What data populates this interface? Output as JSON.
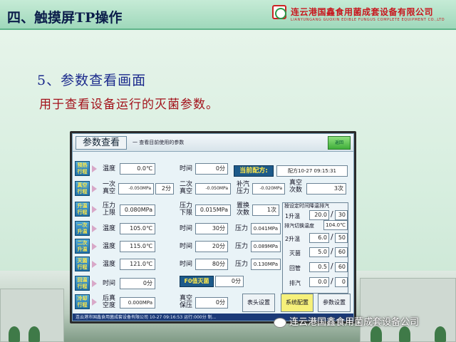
{
  "slide": {
    "title": "四、触摸屏TP操作",
    "company_cn": "连云港国鑫食用菌成套设备有限公司",
    "company_en": "LIANYUNGANG GUOXIN EDIBLE FUNGUS COMPLETE EQUIPMENT CO.,LTD",
    "sub_heading": "5、参数查看画面",
    "description": "用于查看设备运行的灭菌参数。",
    "watermark": "连云港国鑫食用菌成套设备公司"
  },
  "hmi": {
    "title": "参数查看",
    "subtitle": "一 查看目前使用的参数",
    "return_label": "返回",
    "recipe_label": "当前配方:",
    "recipe_value": "配方10-27 09:15:31",
    "side_buttons": [
      "预热\n行程",
      "真空\n行程",
      "升温\n行程",
      "一次\n升温",
      "二次\n升温",
      "灭菌\n行程",
      "回温\n行程",
      "冷却\n行程"
    ],
    "rows": [
      {
        "label": "温度",
        "value": "0.0℃",
        "label2": "时间",
        "value2": "0分"
      },
      {
        "label": "一次\n真空",
        "value": "-0.050MPa",
        "unit_val": "2分",
        "label2": "二次\n真空",
        "value2": "-0.050MPa",
        "label3": "补汽\n压力",
        "value3": "-0.020MPa",
        "label4": "真空\n次数",
        "value4": "3次"
      },
      {
        "label": "压力\n上限",
        "value": "0.080MPa",
        "label2": "压力\n下限",
        "value2": "0.015MPa",
        "label3": "置换\n次数",
        "value3": "1次"
      },
      {
        "label": "温度",
        "value": "105.0℃",
        "label2": "时间",
        "value2": "30分",
        "label3": "压力",
        "value3": "0.041MPa"
      },
      {
        "label": "温度",
        "value": "115.0℃",
        "label2": "时间",
        "value2": "20分",
        "label3": "压力",
        "value3": "0.089MPa"
      },
      {
        "label": "温度",
        "value": "121.0℃",
        "label2": "时间",
        "value2": "80分",
        "label3": "压力",
        "value3": "0.130MPa"
      },
      {
        "label": "时间",
        "value": "0分"
      },
      {
        "label": "后真\n空度",
        "value": "0.000MPa",
        "label2": "真空\n保压",
        "value2": "0分"
      }
    ],
    "f0": {
      "title": "F0值灭菌",
      "value": "0分"
    },
    "phase": {
      "header": "按设定时间降温排汽",
      "switch_label": "排汽切换温度",
      "switch_value": "104.0℃",
      "items": [
        {
          "label": "1升温",
          "v1": "20.0",
          "v2": "30"
        },
        {
          "label": "2升温",
          "v1": "6.0",
          "v2": "50"
        },
        {
          "label": "灭菌",
          "v1": "5.0",
          "v2": "60"
        },
        {
          "label": "回管",
          "v1": "0.5",
          "v2": "60"
        },
        {
          "label": "排汽",
          "v1": "0.0",
          "v2": "0"
        }
      ]
    },
    "buttons": {
      "header_setting": "表头设置",
      "system_config": "系统配置",
      "param_setting": "参数设置"
    },
    "status": "连云港市国鑫食用菌成套设备有限公司    10-27 09:16:53    运行:000分    制..."
  },
  "colors": {
    "accent_blue": "#1d5a8a",
    "accent_yellow": "#ffe84a",
    "title_red": "#c8171e",
    "return_green": "#3fae3a"
  }
}
